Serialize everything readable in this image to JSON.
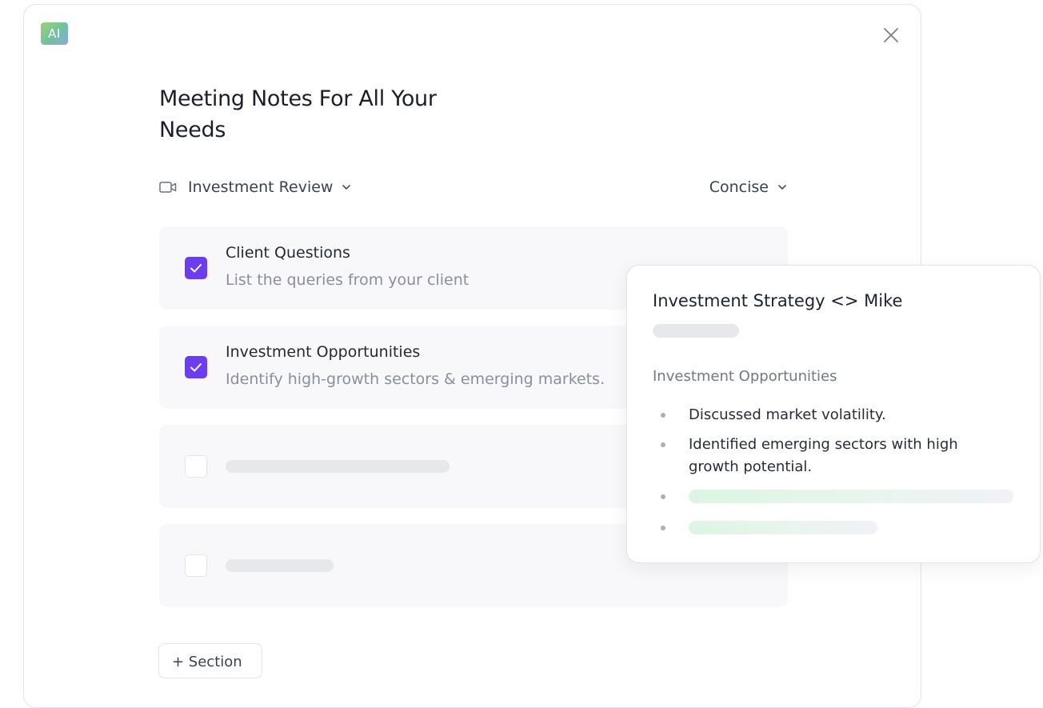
{
  "modal": {
    "badge_label": "AI",
    "close_icon": "close-icon",
    "title": "Meeting Notes For All Your Needs",
    "meeting_selector": {
      "icon": "video-camera-icon",
      "label": "Investment Review"
    },
    "style_selector": {
      "label": "Concise"
    },
    "sections": [
      {
        "checked": true,
        "title": "Client Questions",
        "description": "List the queries from your client"
      },
      {
        "checked": true,
        "title": "Investment Opportunities",
        "description": "Identify high-growth sectors & emerging markets."
      },
      {
        "checked": false,
        "title": "",
        "description": ""
      },
      {
        "checked": false,
        "title": "",
        "description": ""
      }
    ],
    "add_section_label": "+ Section"
  },
  "preview": {
    "title": "Investment Strategy <> Mike",
    "section_heading": "Investment Opportunities",
    "bullets": [
      "Discussed market volatility.",
      "Identified emerging sectors with high growth potential."
    ]
  },
  "colors": {
    "accent": "#6b3cf0",
    "card_background": "#f8f8fa",
    "skeleton": "#e7e8ec",
    "skeleton_green": "#dcf5e2"
  }
}
